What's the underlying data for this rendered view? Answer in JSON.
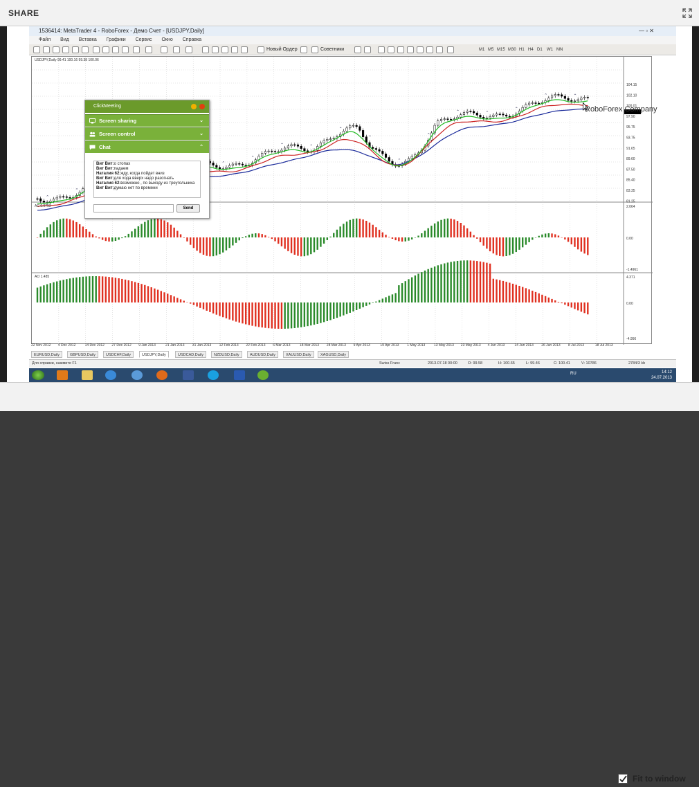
{
  "share": {
    "title": "SHARE",
    "fit_label": "Fit to window"
  },
  "mt": {
    "title": "1536414: MetaTrader 4 - RoboForex - Демо Счет - [USDJPY,Daily]",
    "menu": [
      "Файл",
      "Вид",
      "Вставка",
      "Графики",
      "Сервис",
      "Окно",
      "Справка"
    ],
    "new_order": "Новый Ордер",
    "advisors": "Советники",
    "timeframes": [
      "M1",
      "M5",
      "M15",
      "M30",
      "H1",
      "H4",
      "D1",
      "W1",
      "MN"
    ]
  },
  "chart": {
    "header": "USDJPY,Daily  99.41 100.16 99.38 100.06",
    "price_labels": [
      "104.15",
      "102.10",
      "100.01",
      "97.90",
      "95.75",
      "93.75",
      "91.65",
      "89.60",
      "87.50",
      "85.40",
      "83.35",
      "81.25"
    ],
    "ac_label": "AC 0.0753",
    "ac_scale": [
      "2.064",
      "0.00",
      "-1.4961"
    ],
    "ao_label": "AO 1.485",
    "ao_scale": [
      "4.371",
      "0.00",
      "-4.956"
    ],
    "dates": [
      "22 Nov 2012",
      "4 Dec 2012",
      "14 Dec 2012",
      "27 Dec 2012",
      "9 Jan 2013",
      "21 Jan 2013",
      "31 Jan 2013",
      "12 Feb 2013",
      "22 Feb 2013",
      "6 Mar 2013",
      "18 Mar 2013",
      "28 Mar 2013",
      "9 Apr 2013",
      "19 Apr 2013",
      "1 May 2013",
      "13 May 2013",
      "23 May 2013",
      "4 Jun 2013",
      "14 Jun 2013",
      "26 Jun 2013",
      "8 Jul 2013",
      "18 Jul 2013"
    ],
    "watermark": "RoboForex Company",
    "colors": {
      "up": "#2a8a2a",
      "down": "#e03020",
      "ma_green": "#22bb22",
      "ma_red": "#cc2222",
      "ma_blue": "#1a2a9a"
    }
  },
  "tabs": [
    "EURUSD,Daily",
    "GBPUSD,Daily",
    "USDCHF,Daily",
    "USDJPY,Daily",
    "USDCAD,Daily",
    "NZDUSD,Daily",
    "AUDUSD,Daily",
    "XAUUSD,Daily",
    "XAGUSD,Daily"
  ],
  "status": {
    "help": "Для справки, нажмите F1",
    "template": "Swiss Franc",
    "datetime": "2013.07.18 00:00",
    "open": "O: 99.58",
    "high": "H: 100.65",
    "low": "L: 99.46",
    "close": "C: 100.41",
    "volume": "V: 10786",
    "traffic": "2784/3 kb"
  },
  "taskbar": {
    "lang": "RU",
    "time": "14:12",
    "date": "24.07.2013"
  },
  "clickmeeting": {
    "brand": "ClickMeeting",
    "sections": [
      "Screen sharing",
      "Screen control",
      "Chat"
    ],
    "messages": [
      {
        "user": "Вит Вит:",
        "text": "о стопах"
      },
      {
        "user": "Вит Вит:",
        "text": "падаем"
      },
      {
        "user": "Наталия 62:",
        "text": "жду, когда пойдет вниз"
      },
      {
        "user": "Вит Вит:",
        "text": "для хода вверх надо разогнать"
      },
      {
        "user": "Наталия 62:",
        "text": "возможно , по выходу из треугольника"
      },
      {
        "user": "Вит Вит:",
        "text": "думаю нет по времени"
      }
    ],
    "send": "Send"
  }
}
